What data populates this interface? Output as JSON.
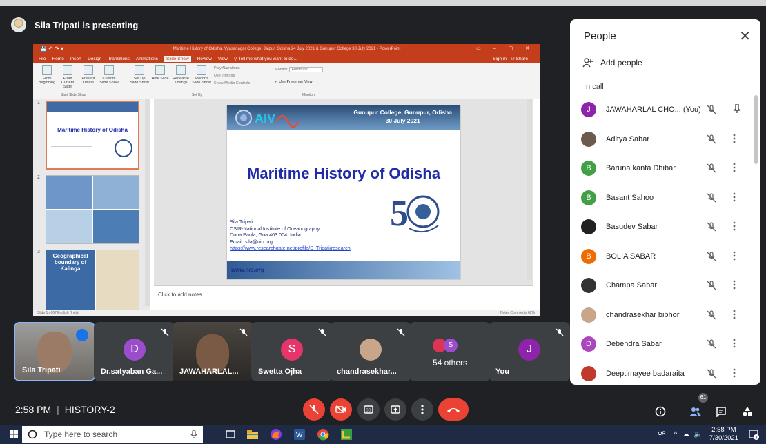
{
  "meet": {
    "presenting_text": "Sila Tripati is presenting",
    "time": "2:58 PM",
    "meeting_name": "HISTORY-2",
    "participants_badge": "61"
  },
  "ppt": {
    "title_bar": "Maritime History of Odisha, Vyasanagar College, Jajpur, Odisha  24 July 2021 & Gunupur College 30 July 2021 - PowerPoint",
    "tabs": [
      "File",
      "Home",
      "Insert",
      "Design",
      "Transitions",
      "Animations",
      "Slide Show",
      "Review",
      "View"
    ],
    "active_tab": "Slide Show",
    "tell_me": "Tell me what you want to do...",
    "sign_in": "Sign in",
    "share": "Share",
    "ribbon": {
      "from_beginning": "From Beginning",
      "from_current": "From Current Slide",
      "present_online": "Present Online",
      "custom_show": "Custom Slide Show",
      "group_start": "Start Slide Show",
      "set_up": "Set Up Slide Show",
      "hide_slide": "Hide Slide",
      "rehearse": "Rehearse Timings",
      "record": "Record Slide Show",
      "group_setup": "Set Up",
      "play_narrations": "Play Narrations",
      "use_timings": "Use Timings",
      "show_media": "Show Media Controls",
      "monitor_label": "Monitor:",
      "monitor_value": "Automatic",
      "presenter_view": "Use Presenter View",
      "group_monitors": "Monitors"
    },
    "slide": {
      "header_sub1": "Gunupur College, Gunupur, Odisha",
      "header_sub2": "30 July 2021",
      "heading": "Maritime History of Odisha",
      "author": "Sila Tripati",
      "org": "CSIR-National Institute of Oceanography",
      "address": "Dona Paula, Goa 403 004, India",
      "email": "Email: sila@nio.org",
      "url": "https://www.researchgate.net/profile/S_Tripati/research",
      "website": "www.nio.org",
      "logo_text": "AIV"
    },
    "thumbs": {
      "t1_num": "1",
      "t1_title": "Maritime History of Odisha",
      "t2_num": "2",
      "t3_num": "3",
      "t3_title": "Geographical boundary of Kalinga"
    },
    "notes_placeholder": "Click to add notes",
    "status_left": "Slide 1 of 67     English (India)",
    "status_right": "Notes    Comments           62%"
  },
  "tiles": [
    {
      "name": "Sila Tripati",
      "letter": "",
      "color": ""
    },
    {
      "name": "Dr.satyaban Ga...",
      "letter": "D",
      "color": "#9c4dcc"
    },
    {
      "name": "JAWAHARLAL...",
      "letter": "",
      "color": ""
    },
    {
      "name": "Swetta Ojha",
      "letter": "S",
      "color": "#e5356b"
    },
    {
      "name": "chandrasekhar...",
      "letter": "",
      "color": ""
    },
    {
      "name": "54 others",
      "letter": "S",
      "color": "#9c4dcc"
    },
    {
      "name": "You",
      "letter": "J",
      "color": "#8e24aa"
    }
  ],
  "people": {
    "title": "People",
    "add_people": "Add people",
    "in_call": "In call",
    "list": [
      {
        "name": "JAWAHARLAL CHO... (You)",
        "letter": "J",
        "color": "#8e24aa"
      },
      {
        "name": "Aditya Sabar",
        "letter": "",
        "color": "#6b5a4e"
      },
      {
        "name": "Baruna kanta Dhibar",
        "letter": "B",
        "color": "#43a047"
      },
      {
        "name": "Basant Sahoo",
        "letter": "B",
        "color": "#43a047"
      },
      {
        "name": "Basudev Sabar",
        "letter": "",
        "color": "#222222"
      },
      {
        "name": "BOLIA SABAR",
        "letter": "B",
        "color": "#ef6c00"
      },
      {
        "name": "Champa Sabar",
        "letter": "",
        "color": "#333333"
      },
      {
        "name": "chandrasekhar bibhor",
        "letter": "",
        "color": "#c9a58a"
      },
      {
        "name": "Debendra Sabar",
        "letter": "D",
        "color": "#ab47bc"
      },
      {
        "name": "Deeptimayee badaraita",
        "letter": "",
        "color": "#c0392b"
      }
    ]
  },
  "taskbar": {
    "search_placeholder": "Type here to search",
    "tray_time": "2:58 PM",
    "tray_date": "7/30/2021",
    "notif_count": "3"
  }
}
